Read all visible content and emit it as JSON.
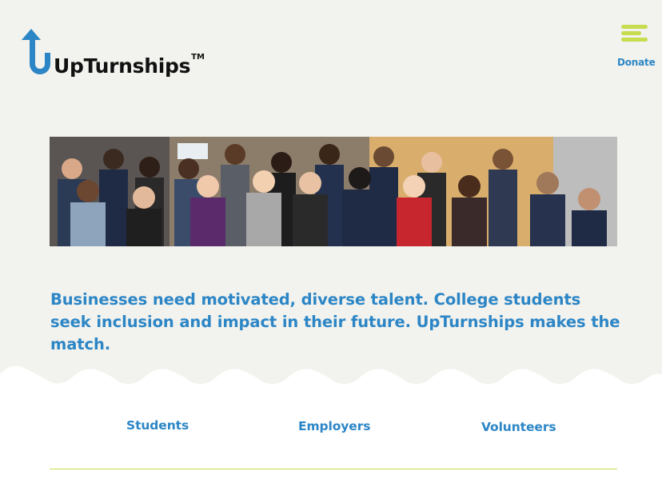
{
  "header": {
    "logo_text": "UpTurnships",
    "logo_trademark": "TM",
    "donate_label": "Donate"
  },
  "hero": {
    "image": "group-photo-of-students"
  },
  "tagline": "Businesses need motivated, diverse talent. College students seek inclusion and impact in their future. UpTurnships makes the match.",
  "nav": {
    "items": [
      {
        "label": "Students"
      },
      {
        "label": "Employers"
      },
      {
        "label": "Volunteers"
      }
    ]
  },
  "colors": {
    "brand_blue": "#2c86c6",
    "accent_green": "#c7dc4e",
    "background": "#f2f2ee"
  }
}
